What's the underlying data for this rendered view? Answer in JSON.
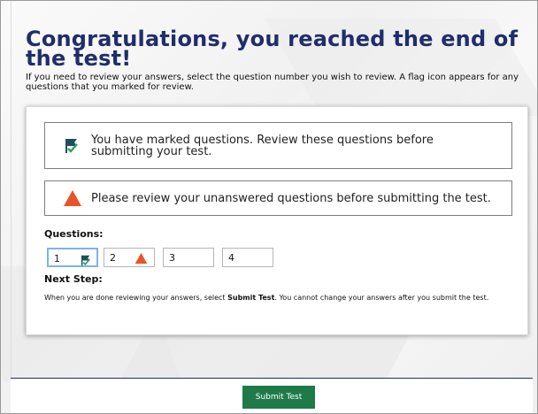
{
  "header": {
    "title": "Congratulations, you reached the end of the test!",
    "intro": "If you need to review your answers, select the question number you wish to review. A flag icon appears for any questions that you marked for review."
  },
  "alerts": {
    "marked": "You have marked questions. Review these questions before submitting your test.",
    "unanswered": "Please review your unanswered questions before submitting the test."
  },
  "questions": {
    "label": "Questions:",
    "items": [
      {
        "number": "1",
        "status": "marked",
        "icon": "flag-check-icon"
      },
      {
        "number": "2",
        "status": "unanswered",
        "icon": "warning-triangle-icon"
      },
      {
        "number": "3",
        "status": "answered",
        "icon": ""
      },
      {
        "number": "4",
        "status": "answered",
        "icon": ""
      }
    ]
  },
  "next_step": {
    "label": "Next Step:",
    "text_before": "When you are done reviewing your answers, select ",
    "text_bold": "Submit Test",
    "text_after": ". You cannot change your answers after you submit the test."
  },
  "footer": {
    "submit_label": "Submit Test"
  },
  "colors": {
    "title": "#1f2e6b",
    "submit_bg": "#1f7a4a",
    "warning": "#e8532a",
    "flag": "#1f4f5f",
    "check": "#2f9e63"
  }
}
